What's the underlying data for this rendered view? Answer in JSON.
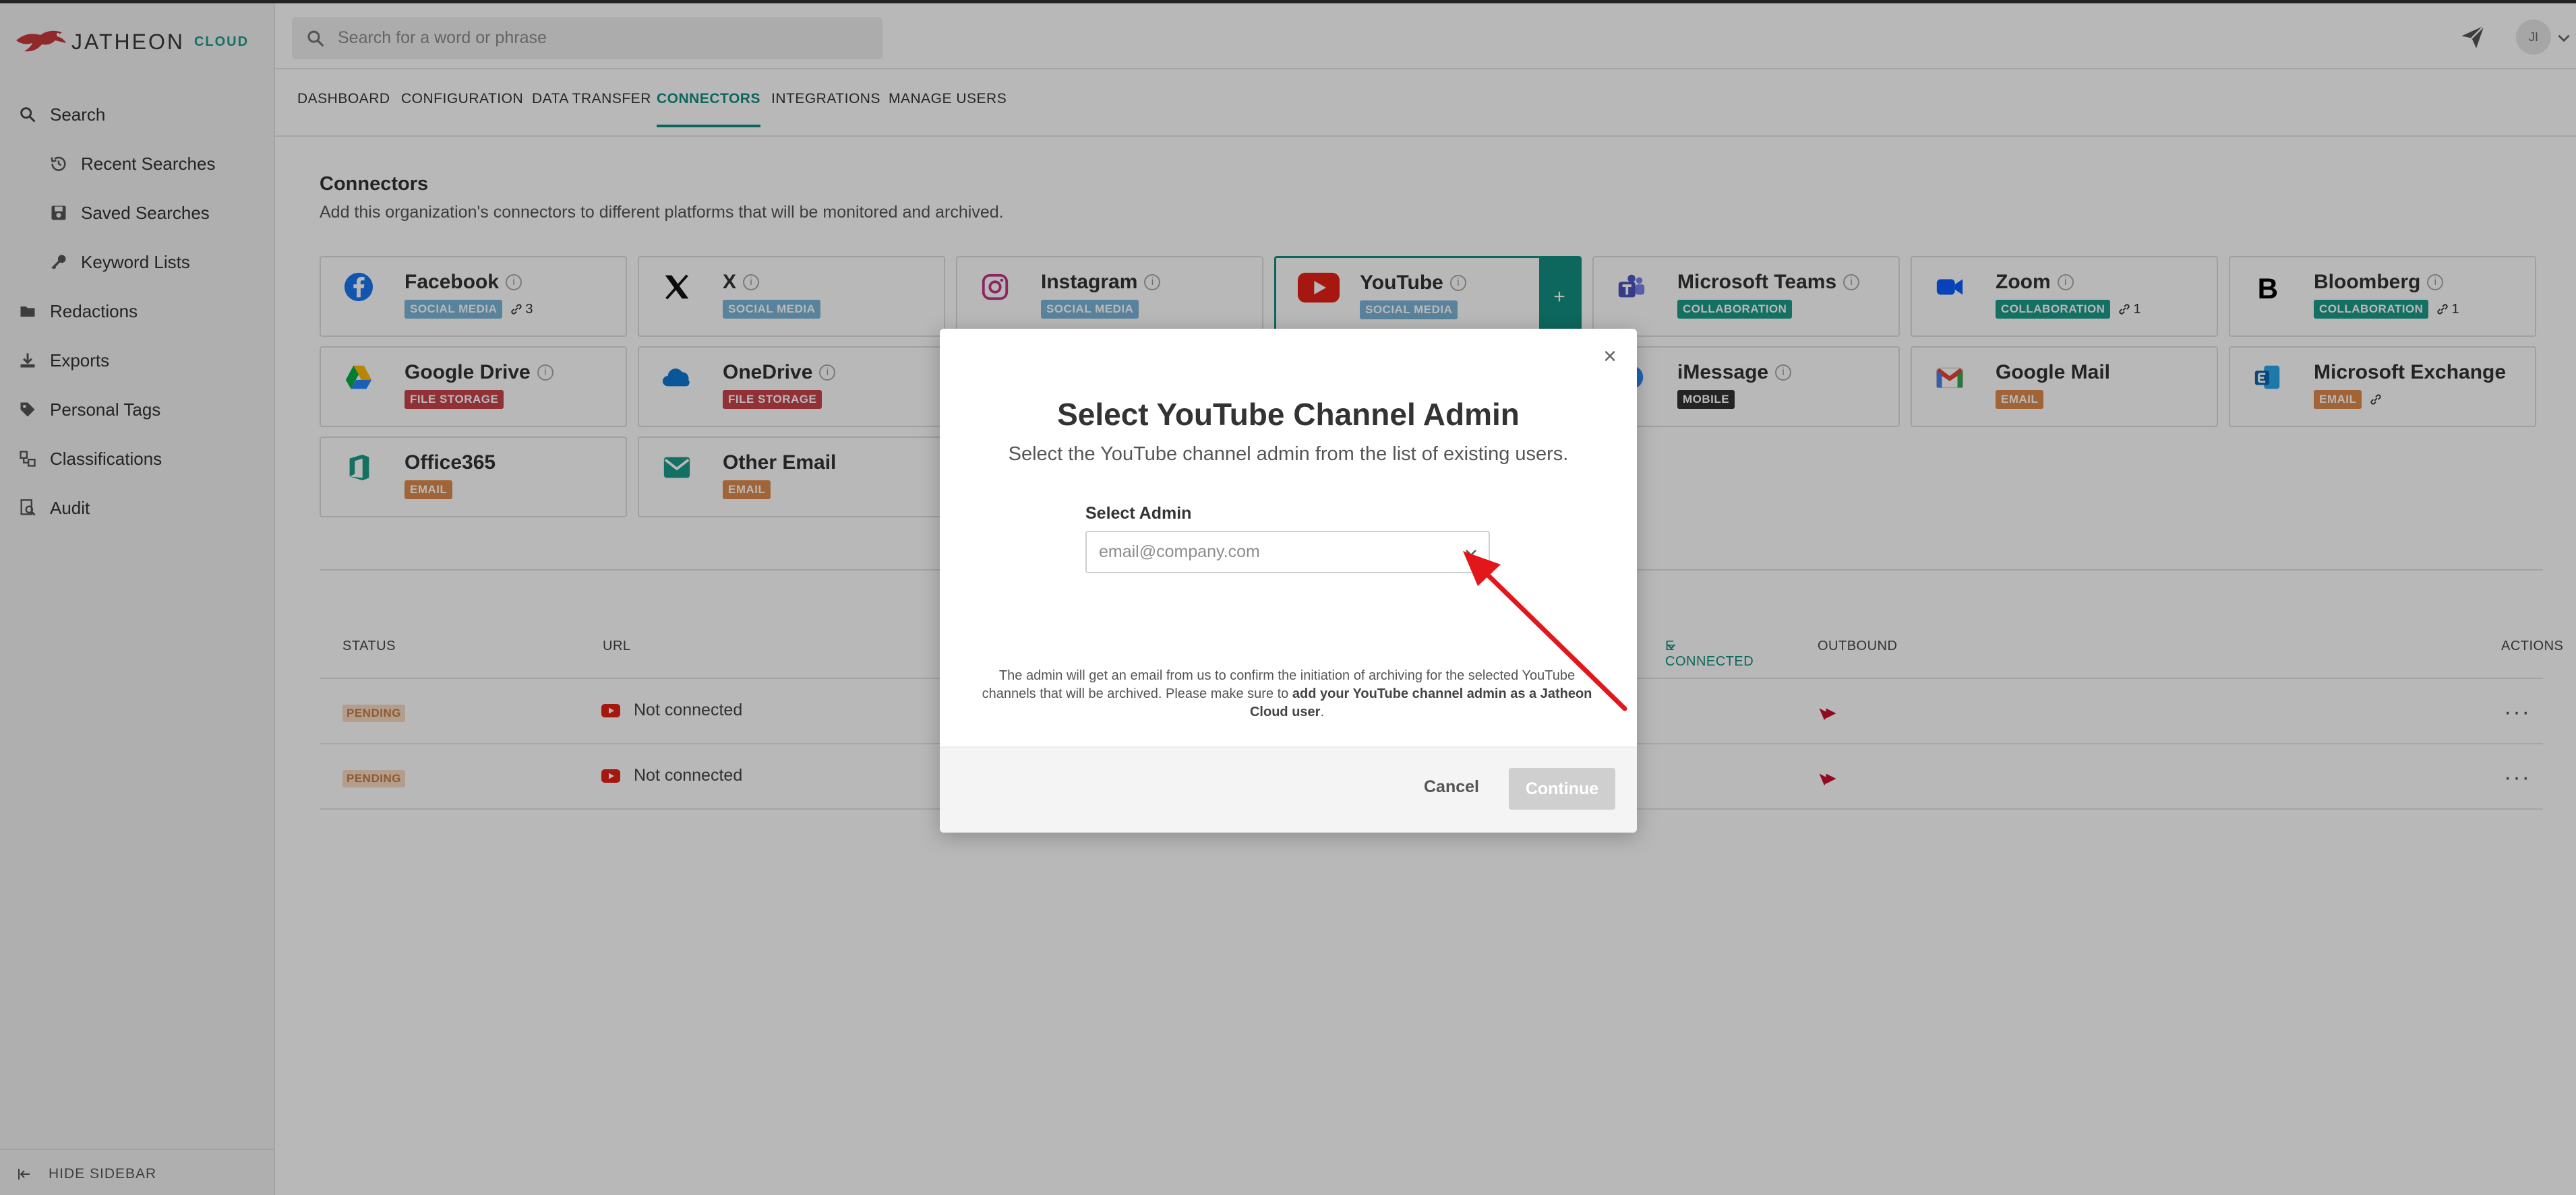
{
  "app": {
    "logo_name": "JATHEON",
    "logo_suffix": "CLOUD",
    "avatar_initials": "JI"
  },
  "search": {
    "placeholder": "Search for a word or phrase"
  },
  "sidebar": {
    "items": [
      {
        "label": "Search",
        "icon": "search-icon"
      },
      {
        "label": "Recent Searches",
        "icon": "history-icon"
      },
      {
        "label": "Saved Searches",
        "icon": "save-icon"
      },
      {
        "label": "Keyword Lists",
        "icon": "key-icon"
      },
      {
        "label": "Redactions",
        "icon": "redaction-icon"
      },
      {
        "label": "Exports",
        "icon": "export-icon"
      },
      {
        "label": "Personal Tags",
        "icon": "tag-icon"
      },
      {
        "label": "Classifications",
        "icon": "classification-icon"
      },
      {
        "label": "Audit",
        "icon": "audit-icon"
      }
    ],
    "hide_label": "HIDE SIDEBAR"
  },
  "tabs": [
    {
      "label": "DASHBOARD"
    },
    {
      "label": "CONFIGURATION"
    },
    {
      "label": "DATA TRANSFER"
    },
    {
      "label": "CONNECTORS",
      "active": true
    },
    {
      "label": "INTEGRATIONS"
    },
    {
      "label": "MANAGE USERS"
    }
  ],
  "page": {
    "title": "Connectors",
    "subtitle": "Add this organization's connectors to different platforms that will be monitored and archived."
  },
  "connectors": [
    {
      "name": "Facebook",
      "tag": "SOCIAL MEDIA",
      "tag_type": "social",
      "links": "3",
      "info": "i"
    },
    {
      "name": "X",
      "tag": "SOCIAL MEDIA",
      "tag_type": "social",
      "info": "i"
    },
    {
      "name": "Instagram",
      "tag": "SOCIAL MEDIA",
      "tag_type": "social",
      "info": "i"
    },
    {
      "name": "YouTube",
      "tag": "SOCIAL MEDIA",
      "tag_type": "social",
      "info": "i",
      "add": "+"
    },
    {
      "name": "Microsoft Teams",
      "tag": "COLLABORATION",
      "tag_type": "collab",
      "info": "i"
    },
    {
      "name": "Zoom",
      "tag": "COLLABORATION",
      "tag_type": "collab",
      "links": "1",
      "info": "i"
    },
    {
      "name": "Bloomberg",
      "tag": "COLLABORATION",
      "tag_type": "collab",
      "links": "1",
      "info": "i"
    },
    {
      "name": "Google Drive",
      "tag": "FILE STORAGE",
      "tag_type": "file",
      "info": "i"
    },
    {
      "name": "OneDrive",
      "tag": "FILE STORAGE",
      "tag_type": "file",
      "info": "i"
    },
    {
      "name": "iMessage",
      "tag": "MOBILE",
      "tag_type": "mobile",
      "info": "i"
    },
    {
      "name": "Google Mail",
      "tag": "EMAIL",
      "tag_type": "email"
    },
    {
      "name": "Microsoft Exchange",
      "tag": "EMAIL",
      "tag_type": "email",
      "links": ""
    },
    {
      "name": "Office365",
      "tag": "EMAIL",
      "tag_type": "email"
    },
    {
      "name": "Other Email",
      "tag": "EMAIL",
      "tag_type": "email"
    }
  ],
  "table": {
    "headers": {
      "status": "STATUS",
      "url": "URL",
      "connected": "E CONNECTED",
      "outbound": "OUTBOUND",
      "actions": "ACTIONS"
    },
    "rows": [
      {
        "status": "PENDING",
        "url": "Not connected",
        "actions": "···"
      },
      {
        "status": "PENDING",
        "url": "Not connected",
        "actions": "···"
      }
    ]
  },
  "modal": {
    "close": "×",
    "title": "Select YouTube Channel Admin",
    "subtitle": "Select the YouTube channel admin from the list of existing users.",
    "label": "Select Admin",
    "placeholder": "email@company.com",
    "note_1": "The admin will get an email from us to confirm the initiation of archiving for the selected YouTube channels that will be archived. Please make sure to ",
    "note_bold": "add your YouTube channel admin as a Jatheon Cloud user",
    "note_2": ".",
    "cancel": "Cancel",
    "continue": "Continue"
  },
  "colors": {
    "accent": "#138f80",
    "annotation": "#e3161b",
    "youtube": "#e62117"
  }
}
